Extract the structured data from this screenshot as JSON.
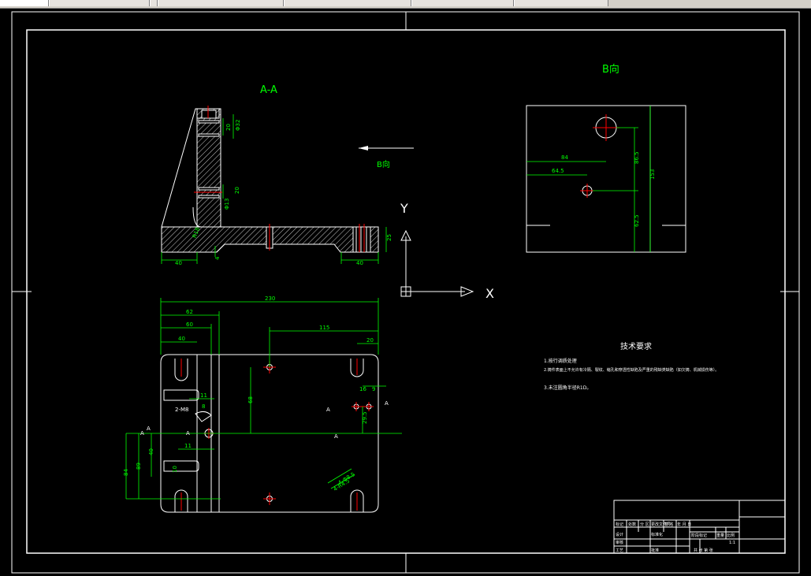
{
  "tabs": [
    "",
    "",
    "",
    "",
    "",
    "",
    ""
  ],
  "views": {
    "section_label": "A-A",
    "view_label": "B向",
    "arrow_label": "B向",
    "ucs_x": "X",
    "ucs_y": "Y"
  },
  "dims_section": {
    "d1": "20",
    "d2": "Φ32",
    "d3": "20",
    "d4": "Φ13",
    "d5": "R18",
    "d6": "40",
    "d7": "40",
    "d8": "4",
    "d9": "25",
    "d10": "Φ20"
  },
  "dims_viewb": {
    "d84": "84",
    "d64": "64.5",
    "d86": "86.5",
    "d62": "62.5",
    "d153": "153"
  },
  "dims_plan": {
    "d230": "230",
    "d62": "62",
    "d60": "60",
    "d40": "40",
    "d115": "115",
    "d20": "20",
    "d68": "68",
    "d16": "16",
    "d9": "9",
    "d295": "29.5",
    "d11a": "11",
    "d8": "8",
    "d2m8": "2-M8",
    "d11b": "11",
    "d40b": "40",
    "d89": "89",
    "d84": "84",
    "d10": "10",
    "d4m": "4-Φ8.5",
    "d4r": "4-R4.5",
    "secA1": "A",
    "secA2": "A",
    "secA3": "A",
    "secA4": "A",
    "secA5": "A",
    "secA6": "A"
  },
  "notes": {
    "title": "技术要求",
    "line1": "1.按行调质处理",
    "line2": "2.铸件表面上不允许有冷隔、裂纹、缩孔和穿透性缺陷及严重的残缺类缺陷（如欠铸、机械损伤等）。",
    "line3": "3.未注圆角半径R1D。"
  },
  "title_block": {
    "c1": "标记",
    "c2": "处数",
    "c3": "分 区",
    "c4": "更改文件号",
    "c5": "签 名",
    "c6": "年 月 日",
    "c7": "设计",
    "c8": "标准化",
    "c9": "阶段标记",
    "c10": "重量",
    "c11": "比例",
    "c12": "1:1",
    "c13": "审核",
    "c14": "工艺",
    "c15": "批准",
    "c16": "共 张 第 张"
  },
  "colors": {
    "line": "#ffffff",
    "dim": "#00ff00",
    "center": "#ff0000",
    "hatch": "#ffffff"
  }
}
